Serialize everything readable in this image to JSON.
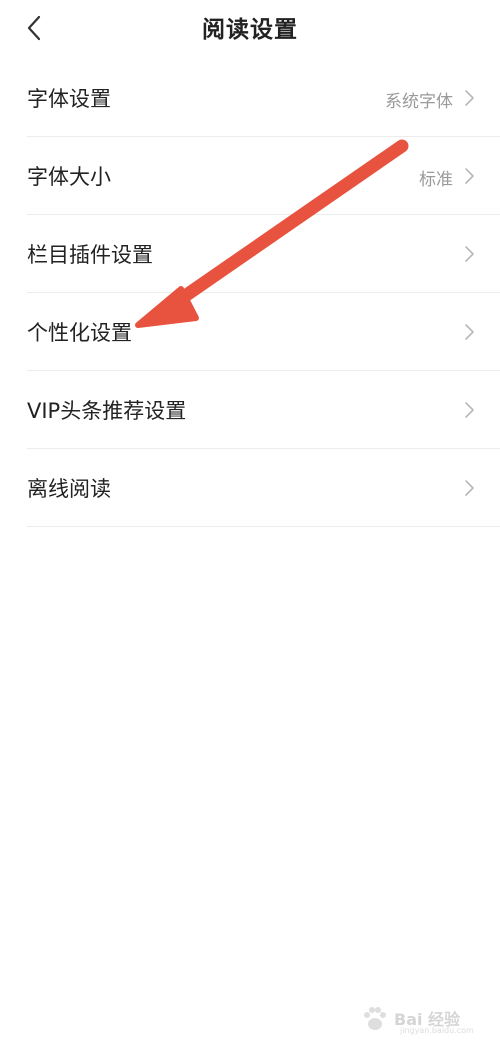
{
  "header": {
    "title": "阅读设置",
    "back_icon": "chevron-left-icon"
  },
  "settings": [
    {
      "id": "font-setting",
      "label": "字体设置",
      "value": "系统字体",
      "icon": "chevron-right-icon"
    },
    {
      "id": "font-size",
      "label": "字体大小",
      "value": "标准",
      "icon": "chevron-right-icon"
    },
    {
      "id": "column-plugin",
      "label": "栏目插件设置",
      "value": "",
      "icon": "chevron-right-icon"
    },
    {
      "id": "personalization",
      "label": "个性化设置",
      "value": "",
      "icon": "chevron-right-icon"
    },
    {
      "id": "vip-headline",
      "label": "VIP头条推荐设置",
      "value": "",
      "icon": "chevron-right-icon"
    },
    {
      "id": "offline-reading",
      "label": "离线阅读",
      "value": "",
      "icon": "chevron-right-icon"
    }
  ],
  "annotation": {
    "arrow_color": "#e8533f",
    "target_item": "个性化设置"
  },
  "watermark": {
    "text": "Bai 经验",
    "subtext": "jingyan.baidu.com",
    "icon": "baidu-paw-icon"
  }
}
